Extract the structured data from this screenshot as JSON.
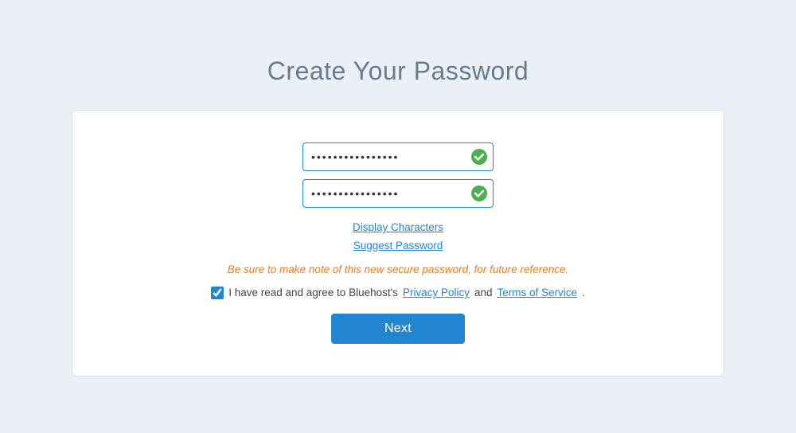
{
  "page": {
    "title": "Create Your Password",
    "background_color": "#eaf0f6"
  },
  "card": {
    "password_placeholder": "••••••••••••••••",
    "confirm_placeholder": "••••••••••••••••",
    "display_characters_label": "Display Characters",
    "suggest_password_label": "Suggest Password",
    "warning_text": "Be sure to make note of this new secure password, for future reference.",
    "agree_prefix": "I have read and agree to Bluehost's ",
    "privacy_policy_label": "Privacy Policy",
    "and_text": " and ",
    "terms_label": "Terms of Service",
    "agree_suffix": ".",
    "next_button_label": "Next",
    "checkbox_checked": true
  }
}
